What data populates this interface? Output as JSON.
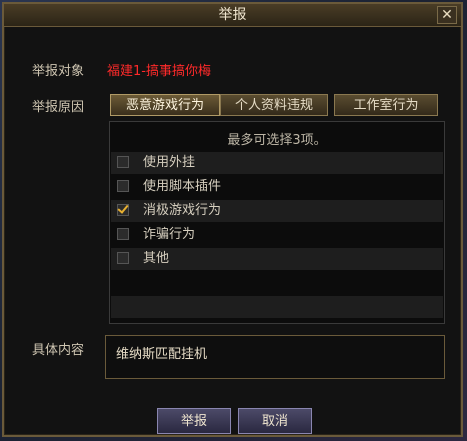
{
  "dialog": {
    "title": "举报",
    "close_glyph": "✕"
  },
  "report": {
    "target_label": "举报对象",
    "target_name": "福建1-搞事搞你梅",
    "reason_label": "举报原因",
    "tabs": [
      {
        "label": "恶意游戏行为",
        "active": true
      },
      {
        "label": "个人资料违规",
        "active": false
      },
      {
        "label": "工作室行为",
        "active": false
      }
    ],
    "hint": "最多可选择3项。",
    "options": [
      {
        "label": "使用外挂",
        "checked": false
      },
      {
        "label": "使用脚本插件",
        "checked": false
      },
      {
        "label": "消极游戏行为",
        "checked": true
      },
      {
        "label": "诈骗行为",
        "checked": false
      },
      {
        "label": "其他",
        "checked": false
      }
    ],
    "content_label": "具体内容",
    "content_value": "维纳斯匹配挂机"
  },
  "buttons": {
    "submit": "举报",
    "cancel": "取消"
  },
  "colors": {
    "target_name": "#ff2a2a",
    "check_accent": "#e8b030"
  }
}
